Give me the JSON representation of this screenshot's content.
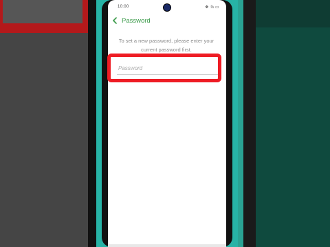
{
  "status_bar": {
    "time": "10:00",
    "right_icons": "❖ ⅞ ▭"
  },
  "header": {
    "back_icon": "chevron-left-icon",
    "title": "Password"
  },
  "main": {
    "description": "To set a new password, please enter your current password first.",
    "password_field": {
      "placeholder": "Password",
      "value": ""
    }
  },
  "colors": {
    "accent": "#3a9a49",
    "highlight": "#ee1c24",
    "phone_case": "#27b3a6"
  }
}
